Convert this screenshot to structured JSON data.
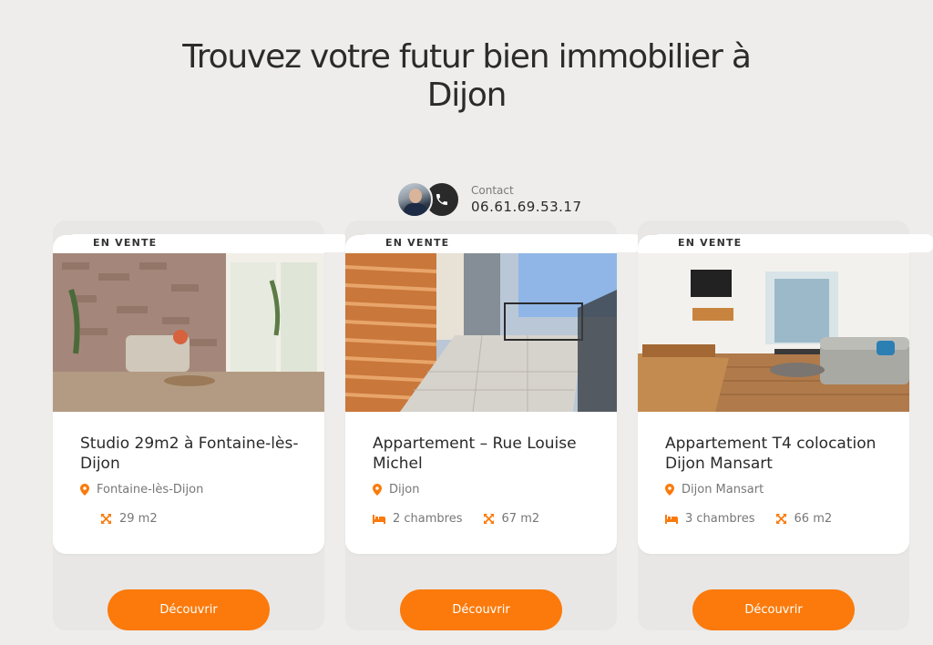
{
  "header": {
    "title_line1": "Trouvez votre futur bien immobilier à",
    "title_line2": "Dijon"
  },
  "contact": {
    "label": "Contact",
    "phone": "06.61.69.53.17"
  },
  "icons": {
    "phone": "phone-icon",
    "location": "location-pin-icon",
    "bed": "bed-icon",
    "area": "area-measure-icon"
  },
  "colors": {
    "accent": "#fb7a0b",
    "background": "#eeedec",
    "card": "#ffffff",
    "text": "#2a2a2a"
  },
  "listings": [
    {
      "badge": "EN VENTE",
      "title": "Studio 29m2 à Fontaine-lès-Dijon",
      "location": "Fontaine-lès-Dijon",
      "bedrooms": "",
      "area": "29 m2",
      "button": "Découvrir"
    },
    {
      "badge": "EN VENTE",
      "title": "Appartement – Rue Louise Michel",
      "location": "Dijon",
      "bedrooms": "2 chambres",
      "area": "67 m2",
      "button": "Découvrir"
    },
    {
      "badge": "EN VENTE",
      "title": "Appartement T4 colocation Dijon Mansart",
      "location": "Dijon Mansart",
      "bedrooms": "3 chambres",
      "area": "66 m2",
      "button": "Découvrir"
    }
  ]
}
